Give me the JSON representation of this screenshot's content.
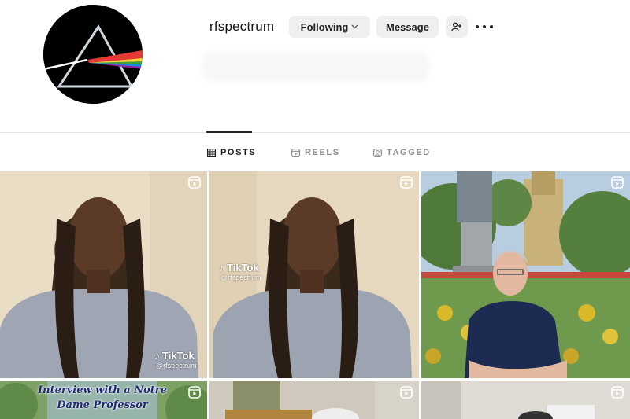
{
  "profile": {
    "username": "rfspectrum",
    "following_label": "Following",
    "message_label": "Message",
    "add_user_icon": "add-user-icon",
    "more_icon": "more-icon"
  },
  "tabs": [
    {
      "label": "POSTS",
      "icon": "grid-icon",
      "active": true
    },
    {
      "label": "REELS",
      "icon": "reels-icon",
      "active": false
    },
    {
      "label": "TAGGED",
      "icon": "tagged-icon",
      "active": false
    }
  ],
  "posts": [
    {
      "type": "reel",
      "watermark": "TikTok",
      "handle": "@rfspectrum"
    },
    {
      "type": "reel",
      "watermark": "TikTok",
      "handle": "@rfspectrum"
    },
    {
      "type": "reel"
    },
    {
      "type": "reel",
      "caption": "Interview with a Notre Dame Professor"
    },
    {
      "type": "reel"
    },
    {
      "type": "reel"
    }
  ],
  "colors": {
    "button_bg": "#efefef",
    "interview_text": "#1c2a78"
  }
}
